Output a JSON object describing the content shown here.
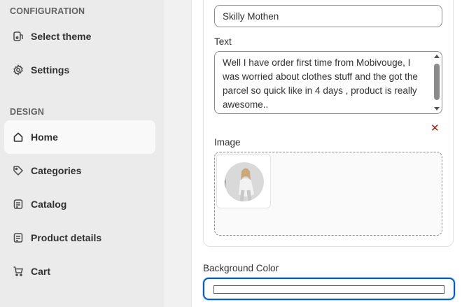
{
  "sidebar": {
    "config_heading": "CONFIGURATION",
    "design_heading": "DESIGN",
    "config_items": [
      {
        "label": "Select theme",
        "icon": "theme-icon"
      },
      {
        "label": "Settings",
        "icon": "gear-icon"
      }
    ],
    "design_items": [
      {
        "label": "Home",
        "icon": "home-icon",
        "active": true
      },
      {
        "label": "Categories",
        "icon": "tag-icon"
      },
      {
        "label": "Catalog",
        "icon": "catalog-icon"
      },
      {
        "label": "Product details",
        "icon": "product-icon"
      },
      {
        "label": "Cart",
        "icon": "cart-icon"
      }
    ]
  },
  "form": {
    "name_value": "Skilly Mothen",
    "text_label": "Text",
    "text_value": "Well I have order first time from Mobivouge, I was worried about clothes stuff and the got the parcel so quick like in 4 days , product is really awesome..",
    "image_label": "Image",
    "remove_glyph": "✕",
    "bg_color_label": "Background Color",
    "bg_color_value": "#ffffff"
  },
  "colors": {
    "focus": "#005bd3",
    "remove": "#8e1f0b",
    "sidebar_bg": "#ebebeb"
  }
}
